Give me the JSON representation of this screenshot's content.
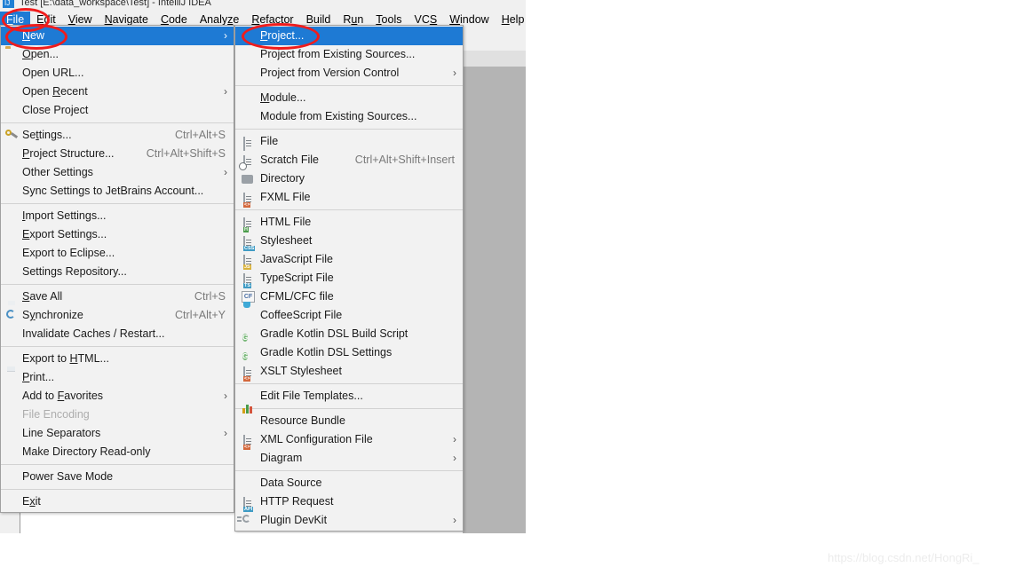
{
  "window": {
    "title": "Test [E:\\data_workspace\\Test] - IntelliJ IDEA",
    "logo_icon": "intellij-logo-icon"
  },
  "menubar": {
    "items": [
      {
        "label": "File",
        "mnemonic": "F",
        "selected": true
      },
      {
        "label": "Edit",
        "mnemonic": "E",
        "selected": false
      },
      {
        "label": "View",
        "mnemonic": "V",
        "selected": false
      },
      {
        "label": "Navigate",
        "mnemonic": "N",
        "selected": false
      },
      {
        "label": "Code",
        "mnemonic": "C",
        "selected": false
      },
      {
        "label": "Analyze",
        "mnemonic": "z",
        "selected": false
      },
      {
        "label": "Refactor",
        "mnemonic": "R",
        "selected": false
      },
      {
        "label": "Build",
        "mnemonic": "",
        "selected": false
      },
      {
        "label": "Run",
        "mnemonic": "u",
        "selected": false
      },
      {
        "label": "Tools",
        "mnemonic": "T",
        "selected": false
      },
      {
        "label": "VCS",
        "mnemonic": "S",
        "selected": false
      },
      {
        "label": "Window",
        "mnemonic": "W",
        "selected": false
      },
      {
        "label": "Help",
        "mnemonic": "H",
        "selected": false
      }
    ]
  },
  "toolbar": {
    "run_icon": "run-play-icon",
    "debug_icon": "debug-bug-icon",
    "coverage_icon": "run-with-coverage-icon"
  },
  "file_menu": {
    "items": [
      {
        "label": "New",
        "icon": "",
        "accel": "",
        "arrow": true,
        "selected": true,
        "disabled": false
      },
      {
        "label": "Open...",
        "icon": "folder-icon",
        "accel": "",
        "arrow": false,
        "selected": false,
        "disabled": false
      },
      {
        "label": "Open URL...",
        "icon": "",
        "accel": "",
        "arrow": false,
        "selected": false,
        "disabled": false
      },
      {
        "label": "Open Recent",
        "icon": "",
        "accel": "",
        "arrow": true,
        "selected": false,
        "disabled": false
      },
      {
        "label": "Close Project",
        "icon": "",
        "accel": "",
        "arrow": false,
        "selected": false,
        "disabled": false
      },
      {
        "separator": true
      },
      {
        "label": "Settings...",
        "icon": "wrench-icon",
        "accel": "Ctrl+Alt+S",
        "arrow": false,
        "selected": false,
        "disabled": false
      },
      {
        "label": "Project Structure...",
        "icon": "project-structure-icon",
        "accel": "Ctrl+Alt+Shift+S",
        "arrow": false,
        "selected": false,
        "disabled": false
      },
      {
        "label": "Other Settings",
        "icon": "",
        "accel": "",
        "arrow": true,
        "selected": false,
        "disabled": false
      },
      {
        "label": "Sync Settings to JetBrains Account...",
        "icon": "",
        "accel": "",
        "arrow": false,
        "selected": false,
        "disabled": false
      },
      {
        "separator": true
      },
      {
        "label": "Import Settings...",
        "icon": "",
        "accel": "",
        "arrow": false,
        "selected": false,
        "disabled": false
      },
      {
        "label": "Export Settings...",
        "icon": "",
        "accel": "",
        "arrow": false,
        "selected": false,
        "disabled": false
      },
      {
        "label": "Export to Eclipse...",
        "icon": "",
        "accel": "",
        "arrow": false,
        "selected": false,
        "disabled": false
      },
      {
        "label": "Settings Repository...",
        "icon": "",
        "accel": "",
        "arrow": false,
        "selected": false,
        "disabled": false
      },
      {
        "separator": true
      },
      {
        "label": "Save All",
        "icon": "save-icon",
        "accel": "Ctrl+S",
        "arrow": false,
        "selected": false,
        "disabled": false
      },
      {
        "label": "Synchronize",
        "icon": "sync-icon",
        "accel": "Ctrl+Alt+Y",
        "arrow": false,
        "selected": false,
        "disabled": false
      },
      {
        "label": "Invalidate Caches / Restart...",
        "icon": "",
        "accel": "",
        "arrow": false,
        "selected": false,
        "disabled": false
      },
      {
        "separator": true
      },
      {
        "label": "Export to HTML...",
        "icon": "",
        "accel": "",
        "arrow": false,
        "selected": false,
        "disabled": false
      },
      {
        "label": "Print...",
        "icon": "printer-icon",
        "accel": "",
        "arrow": false,
        "selected": false,
        "disabled": false
      },
      {
        "label": "Add to Favorites",
        "icon": "",
        "accel": "",
        "arrow": true,
        "selected": false,
        "disabled": false
      },
      {
        "label": "File Encoding",
        "icon": "",
        "accel": "",
        "arrow": false,
        "selected": false,
        "disabled": true
      },
      {
        "label": "Line Separators",
        "icon": "",
        "accel": "",
        "arrow": true,
        "selected": false,
        "disabled": false
      },
      {
        "label": "Make Directory Read-only",
        "icon": "",
        "accel": "",
        "arrow": false,
        "selected": false,
        "disabled": false
      },
      {
        "separator": true
      },
      {
        "label": "Power Save Mode",
        "icon": "",
        "accel": "",
        "arrow": false,
        "selected": false,
        "disabled": false
      },
      {
        "separator": true
      },
      {
        "label": "Exit",
        "icon": "",
        "accel": "",
        "arrow": false,
        "selected": false,
        "disabled": false
      }
    ]
  },
  "new_submenu": {
    "items": [
      {
        "label": "Project...",
        "icon": "",
        "accel": "",
        "arrow": false,
        "selected": true
      },
      {
        "label": "Project from Existing Sources...",
        "icon": "",
        "accel": "",
        "arrow": false,
        "selected": false
      },
      {
        "label": "Project from Version Control",
        "icon": "",
        "accel": "",
        "arrow": true,
        "selected": false
      },
      {
        "separator": true
      },
      {
        "label": "Module...",
        "icon": "",
        "accel": "",
        "arrow": false,
        "selected": false
      },
      {
        "label": "Module from Existing Sources...",
        "icon": "",
        "accel": "",
        "arrow": false,
        "selected": false
      },
      {
        "separator": true
      },
      {
        "label": "File",
        "icon": "file-icon",
        "accel": "",
        "arrow": false,
        "selected": false
      },
      {
        "label": "Scratch File",
        "icon": "scratch-file-icon",
        "accel": "Ctrl+Alt+Shift+Insert",
        "arrow": false,
        "selected": false
      },
      {
        "label": "Directory",
        "icon": "directory-icon",
        "accel": "",
        "arrow": false,
        "selected": false
      },
      {
        "label": "FXML File",
        "icon": "fxml-file-icon",
        "accel": "",
        "arrow": false,
        "selected": false
      },
      {
        "separator": true
      },
      {
        "label": "HTML File",
        "icon": "html-file-icon",
        "accel": "",
        "arrow": false,
        "selected": false
      },
      {
        "label": "Stylesheet",
        "icon": "css-file-icon",
        "accel": "",
        "arrow": false,
        "selected": false
      },
      {
        "label": "JavaScript File",
        "icon": "js-file-icon",
        "accel": "",
        "arrow": false,
        "selected": false
      },
      {
        "label": "TypeScript File",
        "icon": "ts-file-icon",
        "accel": "",
        "arrow": false,
        "selected": false
      },
      {
        "label": "CFML/CFC file",
        "icon": "cfml-file-icon",
        "accel": "",
        "arrow": false,
        "selected": false
      },
      {
        "label": "CoffeeScript File",
        "icon": "coffeescript-file-icon",
        "accel": "",
        "arrow": false,
        "selected": false
      },
      {
        "label": "Gradle Kotlin DSL Build Script",
        "icon": "gradle-icon",
        "accel": "",
        "arrow": false,
        "selected": false
      },
      {
        "label": "Gradle Kotlin DSL Settings",
        "icon": "gradle-icon",
        "accel": "",
        "arrow": false,
        "selected": false
      },
      {
        "label": "XSLT Stylesheet",
        "icon": "xslt-file-icon",
        "accel": "",
        "arrow": false,
        "selected": false
      },
      {
        "separator": true
      },
      {
        "label": "Edit File Templates...",
        "icon": "",
        "accel": "",
        "arrow": false,
        "selected": false
      },
      {
        "separator": true
      },
      {
        "label": "Resource Bundle",
        "icon": "resource-bundle-icon",
        "accel": "",
        "arrow": false,
        "selected": false
      },
      {
        "label": "XML Configuration File",
        "icon": "xml-config-icon",
        "accel": "",
        "arrow": true,
        "selected": false
      },
      {
        "label": "Diagram",
        "icon": "",
        "accel": "",
        "arrow": true,
        "selected": false
      },
      {
        "separator": true
      },
      {
        "label": "Data Source",
        "icon": "data-source-icon",
        "accel": "",
        "arrow": false,
        "selected": false
      },
      {
        "label": "HTTP Request",
        "icon": "http-request-icon",
        "accel": "",
        "arrow": false,
        "selected": false
      },
      {
        "label": "Plugin DevKit",
        "icon": "plugin-devkit-icon",
        "accel": "",
        "arrow": true,
        "selected": false
      }
    ]
  },
  "annotations": {
    "color": "#f01c1c",
    "circles": [
      "file-menu-highlight",
      "new-item-highlight",
      "project-item-highlight"
    ]
  },
  "watermark": {
    "text": "https://blog.csdn.net/HongRi_"
  }
}
